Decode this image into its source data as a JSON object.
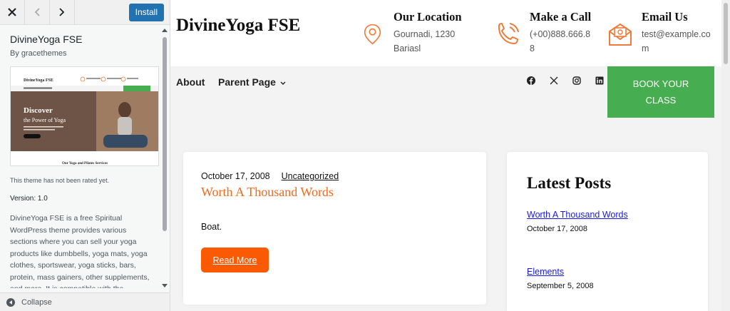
{
  "panel": {
    "install_label": "Install",
    "close_icon": "close-icon",
    "back_icon": "chevron-left-icon",
    "forward_icon": "chevron-right-icon",
    "theme_name": "DivineYoga FSE",
    "theme_author": "By gracethemes",
    "rating_text": "This theme has not been rated yet.",
    "version_text": "Version: 1.0",
    "description": "DivineYoga FSE is a free Spiritual WordPress theme provides various sections where you can sell your yoga products like dumbbells, yoga mats, yoga clothes, sportswear, yoga sticks, bars, protein, mass gainers, other supplements, and more. It is compatible with the",
    "collapse_label": "Collapse",
    "accent_color": "#2271b1"
  },
  "header": {
    "site_title": "DivineYoga FSE",
    "location_title": "Our Location",
    "location_line1": "Gournadi, 1230",
    "location_line2": "Bariasl",
    "call_title": "Make a Call",
    "call_line1": "(+00)888.666.8",
    "call_line2": "8",
    "email_title": "Email Us",
    "email_line1": "test@example.co",
    "email_line2": "m",
    "icon_color": "#f07a3a"
  },
  "nav": {
    "about": "About",
    "parent": "Parent Page",
    "book_line1": "BOOK YOUR",
    "book_line2": "CLASS",
    "book_color": "#46ad50",
    "social": [
      "facebook-icon",
      "x-icon",
      "instagram-icon",
      "linkedin-icon"
    ]
  },
  "post": {
    "date": "October 17, 2008",
    "category": "Uncategorized",
    "title": "Worth A Thousand Words",
    "excerpt": "Boat.",
    "read_more": "Read More",
    "button_color": "#fb5a05"
  },
  "sidebar": {
    "title": "Latest Posts",
    "items": [
      {
        "title": "Worth A Thousand Words",
        "date": "October 17, 2008"
      },
      {
        "title": "Elements",
        "date": "September 5, 2008"
      }
    ]
  },
  "thumb": {
    "site_title": "DivineYoga FSE",
    "hero_line1": "Discover",
    "hero_line2": "the Power of Yoga",
    "section_title": "Our Yoga and Pilates Services"
  }
}
